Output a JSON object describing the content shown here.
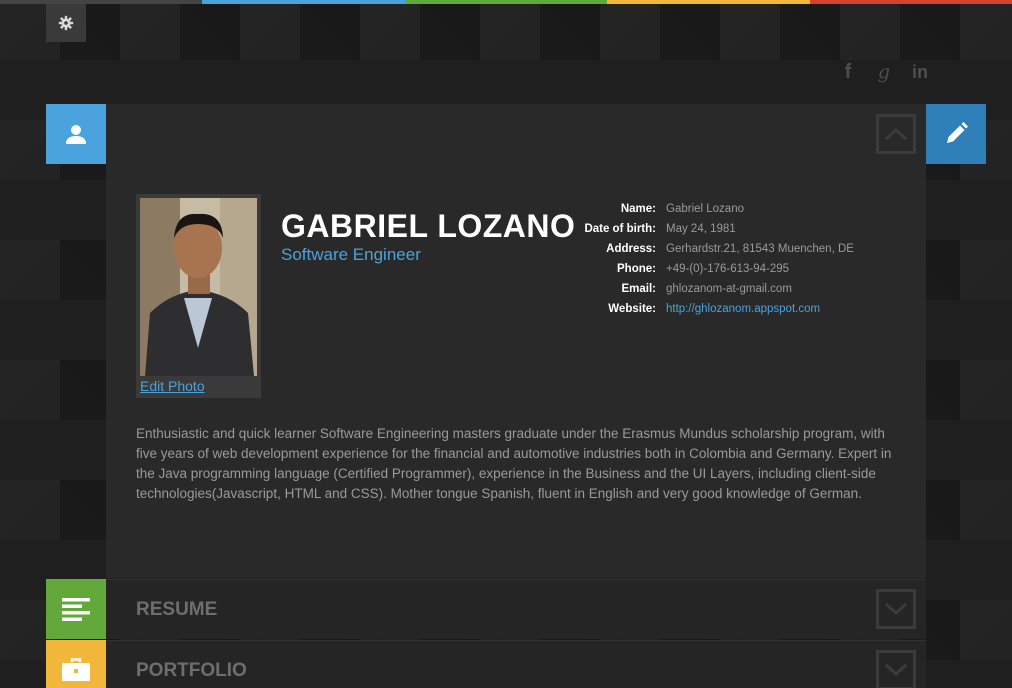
{
  "top_bar_colors": [
    "#444444",
    "#4aa3dc",
    "#62a83a",
    "#f2b63a",
    "#d7412f"
  ],
  "settings": {
    "icon": "gear-icon"
  },
  "social": {
    "facebook": "f",
    "google": "g",
    "linkedin": "in"
  },
  "profile": {
    "name": "GABRIEL LOZANO",
    "title": "Software Engineer",
    "edit_photo_label": "Edit Photo",
    "details": [
      {
        "label": "Name:",
        "value": "Gabriel Lozano"
      },
      {
        "label": "Date of birth:",
        "value": "May 24, 1981"
      },
      {
        "label": "Address:",
        "value": "Gerhardstr.21, 81543 Muenchen, DE"
      },
      {
        "label": "Phone:",
        "value": "+49-(0)-176-613-94-295"
      },
      {
        "label": "Email:",
        "value": "ghlozanom-at-gmail.com"
      },
      {
        "label": "Website:",
        "value": "http://ghlozanom.appspot.com"
      }
    ],
    "bio": "Enthusiastic and quick learner Software Engineering masters graduate under the Erasmus Mundus scholarship program, with five years of web development experience for the financial and automotive industries both in Colombia and Germany. Expert in the Java programming language (Certified Programmer), experience in the Business and the UI Layers, including client-side technologies(Javascript, HTML and CSS). Mother tongue Spanish, fluent in English and very good knowledge of German."
  },
  "sections": [
    {
      "title": "RESUME",
      "color": "#62a83a",
      "icon": "list-icon"
    },
    {
      "title": "PORTFOLIO",
      "color": "#f2b63a",
      "icon": "briefcase-icon"
    }
  ],
  "colors": {
    "profile_icon_bg": "#4aa3dc",
    "edit_icon_bg": "#2f7fb8"
  }
}
